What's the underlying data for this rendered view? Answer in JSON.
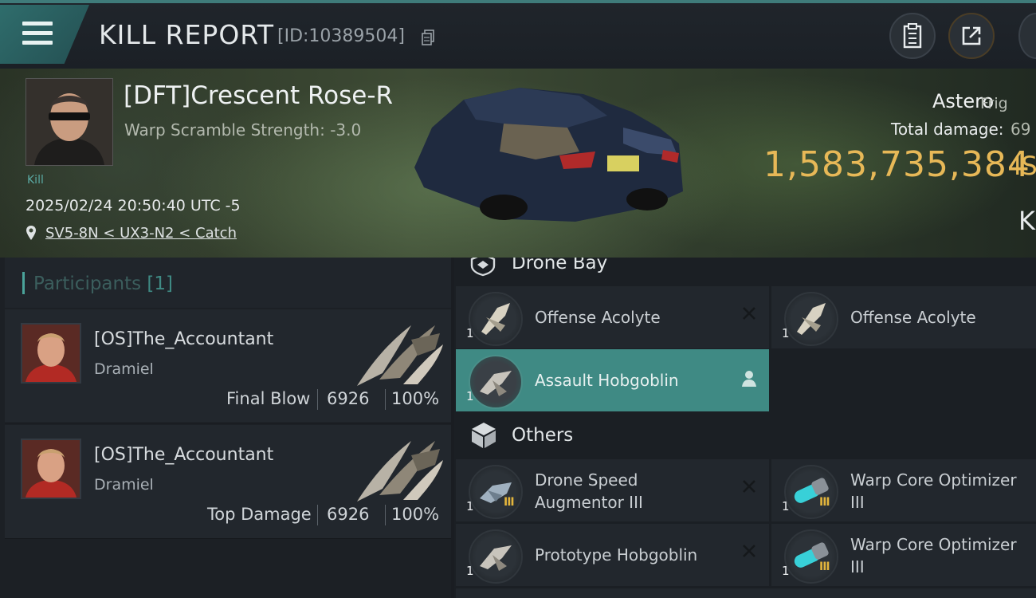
{
  "header": {
    "title": "KILL REPORT",
    "report_id": "[ID:10389504]"
  },
  "victim": {
    "name": "[DFT]Crescent Rose-R",
    "warp_scramble": "Warp Scramble Strength: -3.0",
    "kill_label": "Kill",
    "timestamp": "2025/02/24 20:50:40 UTC -5",
    "location": "SV5-8N < UX3-N2 < Catch",
    "ship_name": "Astero",
    "ship_class": "Frig",
    "total_damage_label": "Total damage:",
    "total_damage_value": "69",
    "isk_value": "1,583,735,384",
    "isk_unit": "IS",
    "partial_letter": "K"
  },
  "participants": {
    "title": "Participants",
    "count": "[1]",
    "list": [
      {
        "name": "[OS]The_Accountant",
        "corp": "Dramiel",
        "role": "Final Blow",
        "damage": "6926",
        "percent": "100%"
      },
      {
        "name": "[OS]The_Accountant",
        "corp": "Dramiel",
        "role": "Top Damage",
        "damage": "6926",
        "percent": "100%"
      }
    ]
  },
  "sections": {
    "drone_bay": "Drone Bay",
    "others": "Others"
  },
  "drone_bay_items": [
    {
      "name": "Offense  Acolyte",
      "qty": "1",
      "tier": ""
    },
    {
      "name": "Offense  Acolyte",
      "qty": "1",
      "tier": ""
    },
    {
      "name": "Assault  Hobgoblin",
      "qty": "1",
      "tier": ""
    }
  ],
  "other_items": [
    {
      "name_line1": "Drone Speed",
      "name_line2": "Augmentor III",
      "qty": "1",
      "tier": "III"
    },
    {
      "name_line1": "Warp Core Optimizer",
      "name_line2": "III",
      "qty": "1",
      "tier": "III"
    },
    {
      "name_line1": "Prototype  Hobgoblin",
      "name_line2": "",
      "qty": "1",
      "tier": ""
    },
    {
      "name_line1": "Warp Core Optimizer",
      "name_line2": "III",
      "qty": "1",
      "tier": "III"
    }
  ],
  "icons": {
    "menu": "menu-icon",
    "copy": "copy-icon",
    "clipboard": "clipboard-icon",
    "share": "share-icon",
    "pin": "location-pin-icon",
    "remove": "close-icon",
    "pilot": "person-icon"
  },
  "colors": {
    "accent": "#3f8a84",
    "isk": "#e7b857",
    "tier": "#e3b53c"
  }
}
